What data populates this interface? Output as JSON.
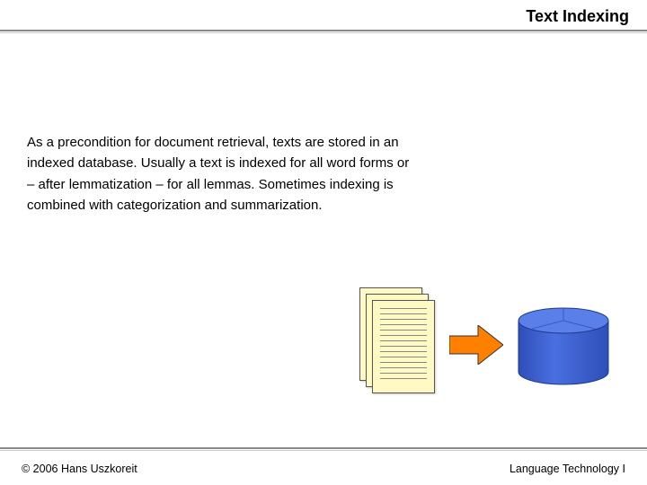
{
  "header": {
    "title": "Text Indexing"
  },
  "body": {
    "paragraph": "As a precondition for document retrieval, texts are stored in an indexed database. Usually a text is indexed for all word forms or – after lemmatization – for all lemmas. Sometimes indexing is combined with categorization and summarization."
  },
  "footer": {
    "left": "© 2006 Hans Uszkoreit",
    "right": "Language Technology I"
  },
  "diagram": {
    "doc_color": "#FFF9C4",
    "arrow_color": "#FF7F00",
    "cylinder_fill": "#3B5FD9",
    "cylinder_top": "#5A7FE8"
  }
}
